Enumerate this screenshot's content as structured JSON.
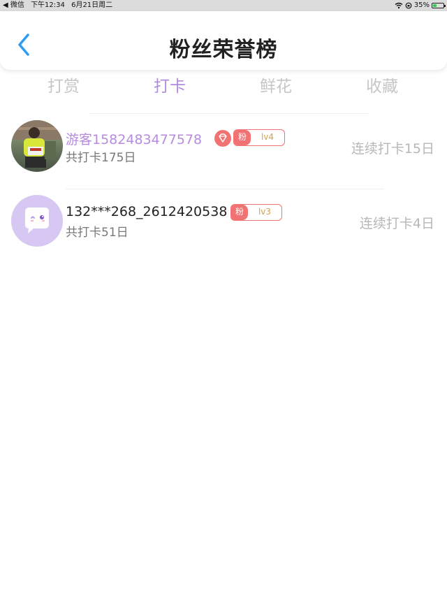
{
  "status_bar": {
    "back_app": "◀ 微信",
    "time": "下午12:34",
    "date": "6月21日周二",
    "battery": "35%",
    "battery_level": 0.35,
    "battery_color": "#34c759"
  },
  "header": {
    "title": "粉丝荣誉榜",
    "back_icon": "chevron-left-icon",
    "back_color": "#2a9df4"
  },
  "tabs": [
    {
      "label": "打赏",
      "active": false
    },
    {
      "label": "打卡",
      "active": true
    },
    {
      "label": "鲜花",
      "active": false
    },
    {
      "label": "收藏",
      "active": false
    }
  ],
  "colors": {
    "accent": "#b08be0",
    "badge_red": "#f07272",
    "level_text": "#d4a24a"
  },
  "rows": [
    {
      "name": "游客1582483477578",
      "total": "共打卡175日",
      "streak": "连续打卡15日",
      "fan_label": "粉",
      "level": "lv4",
      "has_diamond": true,
      "avatar": "photo"
    },
    {
      "name": "132***268_2612420538",
      "total": "共打卡51日",
      "streak": "连续打卡4日",
      "fan_label": "粉",
      "level": "lv3",
      "has_diamond": false,
      "avatar": "default-chat-icon"
    }
  ]
}
